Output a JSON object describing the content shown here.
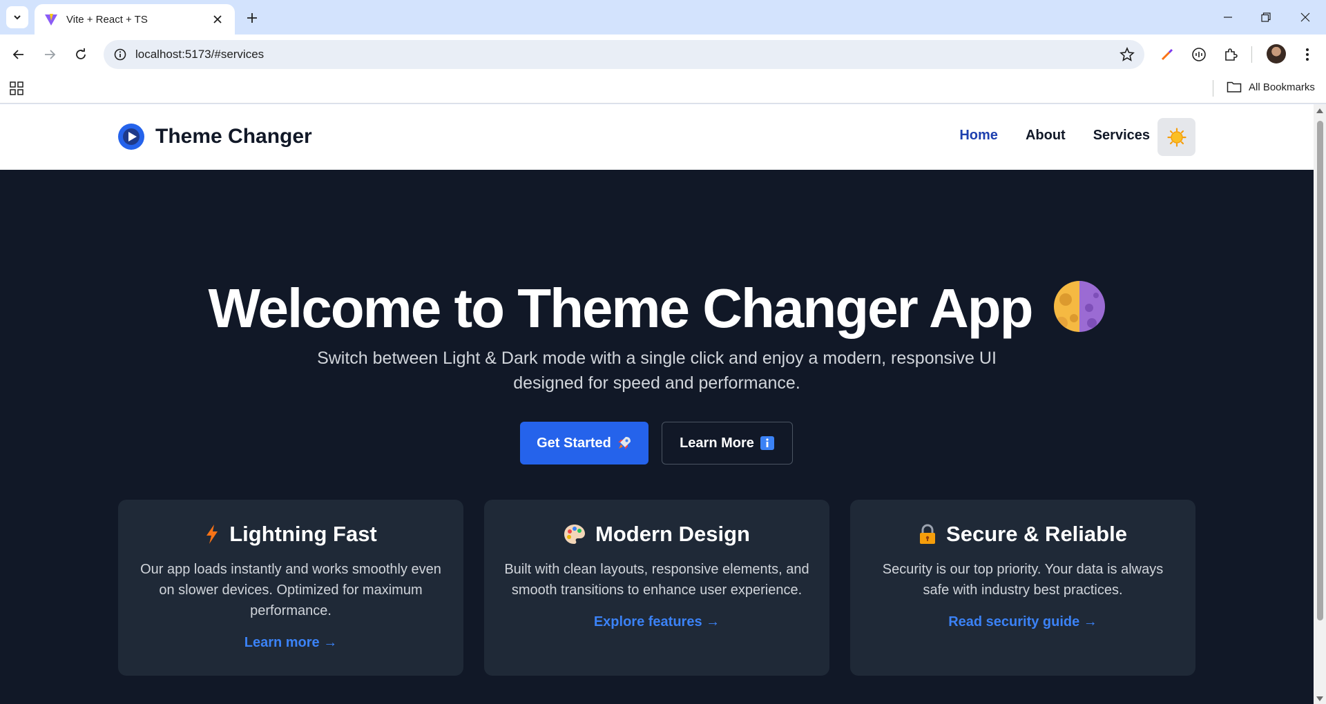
{
  "browser": {
    "tab_title": "Vite + React + TS",
    "url": "localhost:5173/#services",
    "all_bookmarks_label": "All Bookmarks"
  },
  "site": {
    "brand_name": "Theme Changer",
    "nav": [
      {
        "label": "Home",
        "active": true
      },
      {
        "label": "About",
        "active": false
      },
      {
        "label": "Services",
        "active": false
      }
    ],
    "theme_toggle_icon": "sun-icon"
  },
  "hero": {
    "title": "Welcome to Theme Changer App",
    "subtitle": "Switch between Light & Dark mode with a single click and enjoy a modern, responsive UI designed for speed and performance.",
    "primary_button": "Get Started",
    "secondary_button": "Learn More"
  },
  "cards": [
    {
      "icon": "lightning-icon",
      "title": "Lightning Fast",
      "text": "Our app loads instantly and works smoothly even on slower devices. Optimized for maximum performance.",
      "link": "Learn more →"
    },
    {
      "icon": "palette-icon",
      "title": "Modern Design",
      "text": "Built with clean layouts, responsive elements, and smooth transitions to enhance user experience.",
      "link": "Explore features →"
    },
    {
      "icon": "lock-icon",
      "title": "Secure & Reliable",
      "text": "Security is our top priority. Your data is always safe with industry best practices.",
      "link": "Read security guide →"
    }
  ],
  "colors": {
    "page_bg": "#111827",
    "card_bg": "#1f2937",
    "accent": "#2563eb",
    "link": "#3b82f6",
    "nav_active": "#1e40af"
  }
}
